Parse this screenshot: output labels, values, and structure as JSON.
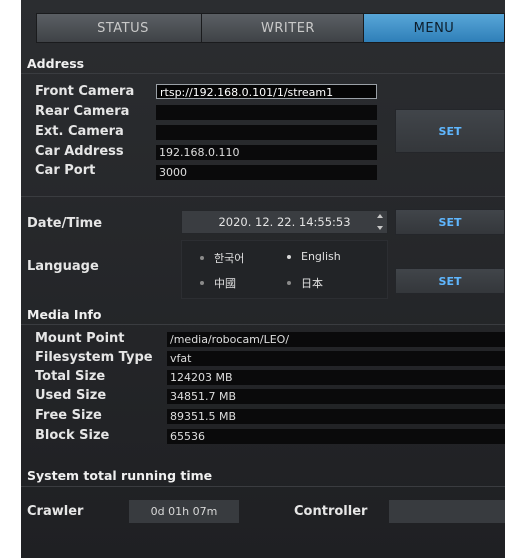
{
  "tabs": [
    {
      "label": "STATUS"
    },
    {
      "label": "WRITER"
    },
    {
      "label": "MENU"
    }
  ],
  "address": {
    "title": "Address",
    "front_camera": {
      "label": "Front Camera",
      "value": "rtsp://192.168.0.101/1/stream1"
    },
    "rear_camera": {
      "label": "Rear Camera",
      "value": ""
    },
    "ext_camera": {
      "label": "Ext. Camera",
      "value": ""
    },
    "car_address": {
      "label": "Car Address",
      "value": "192.168.0.110"
    },
    "car_port": {
      "label": "Car Port",
      "value": "3000"
    },
    "set_label": "SET"
  },
  "datetime": {
    "label": "Date/Time",
    "value": "2020. 12. 22. 14:55:53",
    "set_label": "SET"
  },
  "language": {
    "label": "Language",
    "options": [
      "한국어",
      "English",
      "中國",
      "日本"
    ],
    "selected": "English",
    "set_label": "SET"
  },
  "media": {
    "title": "Media Info",
    "rows": [
      {
        "label": "Mount Point",
        "value": "/media/robocam/LEO/"
      },
      {
        "label": "Filesystem Type",
        "value": "vfat"
      },
      {
        "label": "Total Size",
        "value": "124203 MB"
      },
      {
        "label": "Used Size",
        "value": "34851.7 MB"
      },
      {
        "label": "Free Size",
        "value": "89351.5 MB"
      },
      {
        "label": "Block Size",
        "value": "65536"
      }
    ]
  },
  "runtime": {
    "title": "System total running time",
    "crawler_label": "Crawler",
    "crawler_value": "0d 01h 07m",
    "controller_label": "Controller",
    "controller_value": ""
  },
  "colors": {
    "accent": "#3d8fcb",
    "set_text": "#5fb7ff",
    "panel_bg": "#2b2d30"
  }
}
